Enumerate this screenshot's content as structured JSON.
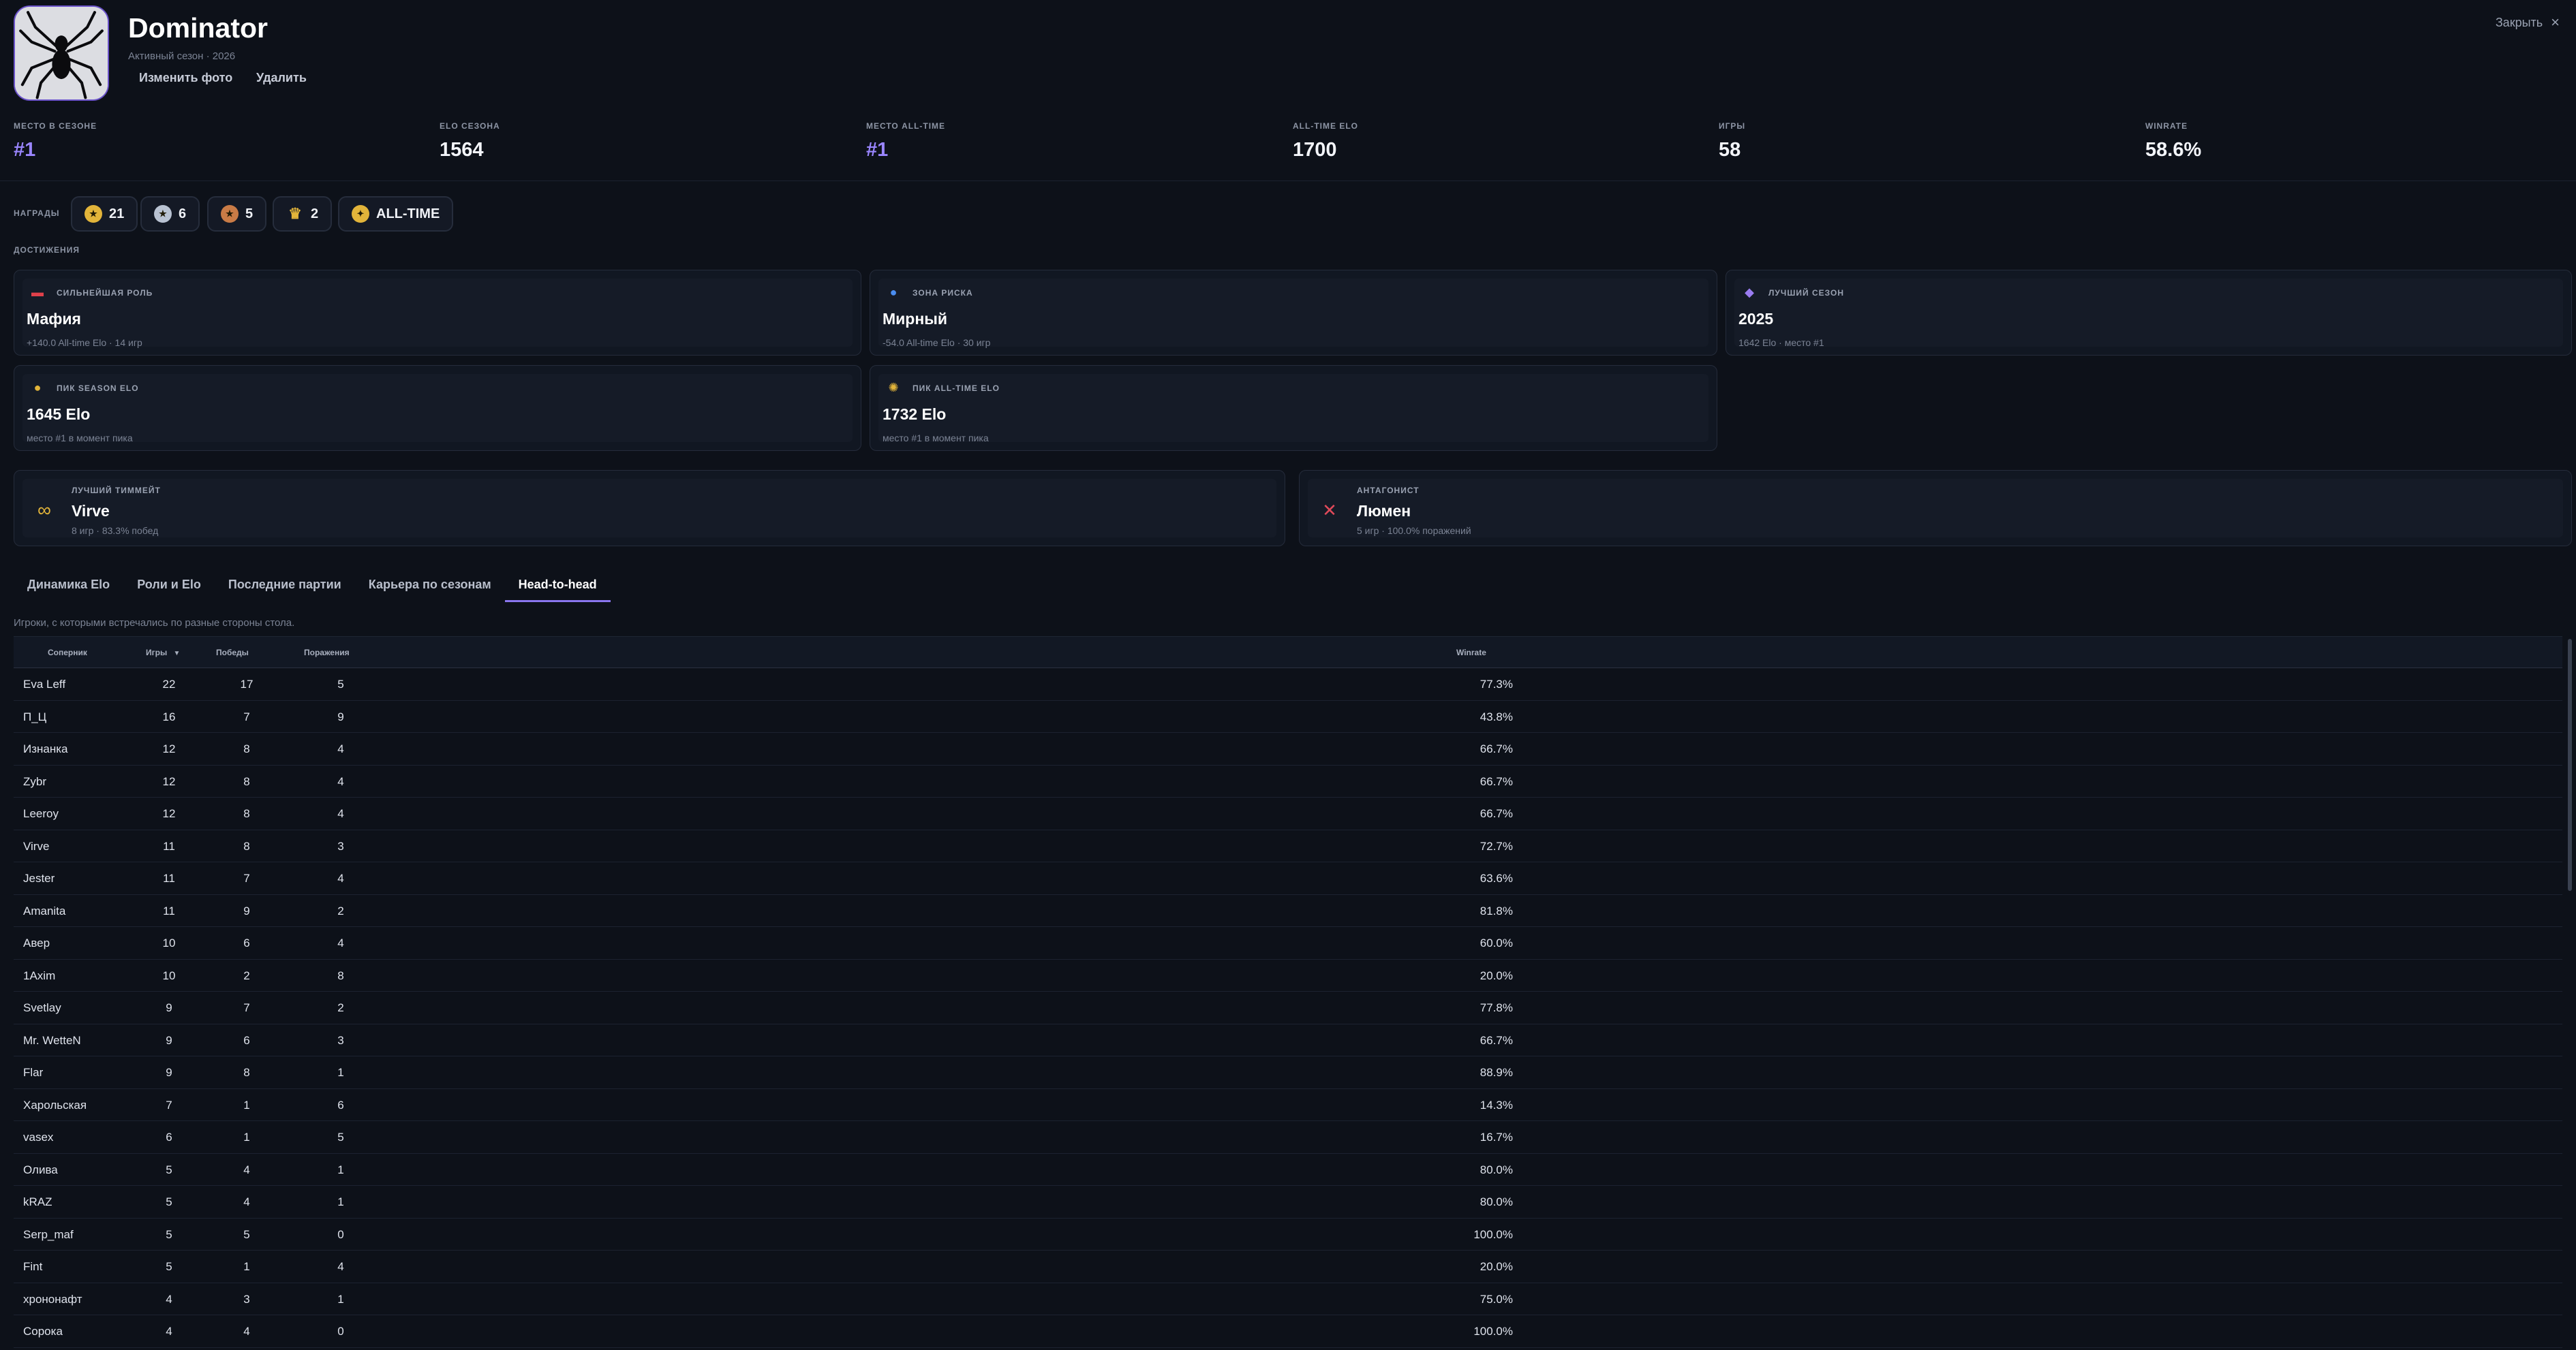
{
  "profile": {
    "name": "Dominator",
    "subtitle": "Активный сезон · 2026",
    "change_photo": "Изменить фото",
    "delete": "Удалить",
    "close": "Закрыть",
    "close_icon": "×"
  },
  "stats": [
    {
      "label": "Место в сезоне",
      "value": "#1",
      "accent": true
    },
    {
      "label": "Elo сезона",
      "value": "1564",
      "accent": false
    },
    {
      "label": "Место all-time",
      "value": "#1",
      "accent": true
    },
    {
      "label": "All-time Elo",
      "value": "1700",
      "accent": false
    },
    {
      "label": "Игры",
      "value": "58",
      "accent": false
    },
    {
      "label": "Winrate",
      "value": "58.6%",
      "accent": false
    }
  ],
  "awards": {
    "label": "НАГРАДЫ",
    "items": [
      {
        "icon": "gold-medal-icon",
        "count": "21",
        "color": "#e2b43a"
      },
      {
        "icon": "silver-medal-icon",
        "count": "6",
        "color": "#b9c2d2"
      },
      {
        "icon": "bronze-medal-icon",
        "count": "5",
        "color": "#c97b46"
      },
      {
        "icon": "trophy-icon",
        "count": "2",
        "color": "#e2b43a"
      },
      {
        "icon": "all-time-badge-icon",
        "count": "ALL-TIME",
        "color": "#e2b43a"
      }
    ]
  },
  "achievements": {
    "label": "ДОСТИЖЕНИЯ",
    "cards": [
      {
        "label": "СИЛЬНЕЙШАЯ РОЛЬ",
        "value": "Мафия",
        "sub": "+140.0 All-time Elo · 14 игр",
        "icon": "mafia-hat-icon"
      },
      {
        "label": "ЗОНА РИСКА",
        "value": "Мирный",
        "sub": "-54.0 All-time Elo · 30 игр",
        "icon": "civilian-icon"
      },
      {
        "label": "ЛУЧШИЙ СЕЗОН",
        "value": "2025",
        "sub": "1642 Elo · место #1",
        "icon": "season-crest-icon"
      },
      {
        "label": "ПИК SEASON ELO",
        "value": "1645 Elo",
        "sub": "место #1 в момент пика",
        "icon": "medal-icon"
      },
      {
        "label": "ПИК ALL-TIME ELO",
        "value": "1732 Elo",
        "sub": "место #1 в момент пика",
        "icon": "laurel-badge-icon"
      }
    ]
  },
  "relations": [
    {
      "label": "ЛУЧШИЙ ТИММЕЙТ",
      "value": "Virve",
      "sub": "8 игр · 83.3% побед",
      "icon": "infinity-link-icon"
    },
    {
      "label": "АНТАГОНИСТ",
      "value": "Люмен",
      "sub": "5 игр · 100.0% поражений",
      "icon": "crossed-swords-icon"
    }
  ],
  "tabs": [
    "Динамика Elo",
    "Роли и Elo",
    "Последние партии",
    "Карьера по сезонам",
    "Head-to-head"
  ],
  "active_tab": 4,
  "tab_hint": "Игроки, с которыми встречались по разные стороны стола.",
  "table": {
    "headers": {
      "name": "Соперник",
      "games": "Игры",
      "wins": "Победы",
      "losses": "Поражения",
      "winrate": "Winrate"
    },
    "sort_icon": "sort-down-icon",
    "rows": [
      [
        "Eva Leff",
        "22",
        "17",
        "5",
        "77.3%"
      ],
      [
        "П_Ц",
        "16",
        "7",
        "9",
        "43.8%"
      ],
      [
        "Изнанка",
        "12",
        "8",
        "4",
        "66.7%"
      ],
      [
        "Zybr",
        "12",
        "8",
        "4",
        "66.7%"
      ],
      [
        "Leeroy",
        "12",
        "8",
        "4",
        "66.7%"
      ],
      [
        "Virve",
        "11",
        "8",
        "3",
        "72.7%"
      ],
      [
        "Jester",
        "11",
        "7",
        "4",
        "63.6%"
      ],
      [
        "Amanita",
        "11",
        "9",
        "2",
        "81.8%"
      ],
      [
        "Авер",
        "10",
        "6",
        "4",
        "60.0%"
      ],
      [
        "1Axim",
        "10",
        "2",
        "8",
        "20.0%"
      ],
      [
        "Svetlay",
        "9",
        "7",
        "2",
        "77.8%"
      ],
      [
        "Mr. WetteN",
        "9",
        "6",
        "3",
        "66.7%"
      ],
      [
        "Flar",
        "9",
        "8",
        "1",
        "88.9%"
      ],
      [
        "Харольская",
        "7",
        "1",
        "6",
        "14.3%"
      ],
      [
        "vasex",
        "6",
        "1",
        "5",
        "16.7%"
      ],
      [
        "Олива",
        "5",
        "4",
        "1",
        "80.0%"
      ],
      [
        "kRAZ",
        "5",
        "4",
        "1",
        "80.0%"
      ],
      [
        "Serp_maf",
        "5",
        "5",
        "0",
        "100.0%"
      ],
      [
        "Fint",
        "5",
        "1",
        "4",
        "20.0%"
      ],
      [
        "хрононафт",
        "4",
        "3",
        "1",
        "75.0%"
      ],
      [
        "Сорока",
        "4",
        "4",
        "0",
        "100.0%"
      ]
    ]
  }
}
